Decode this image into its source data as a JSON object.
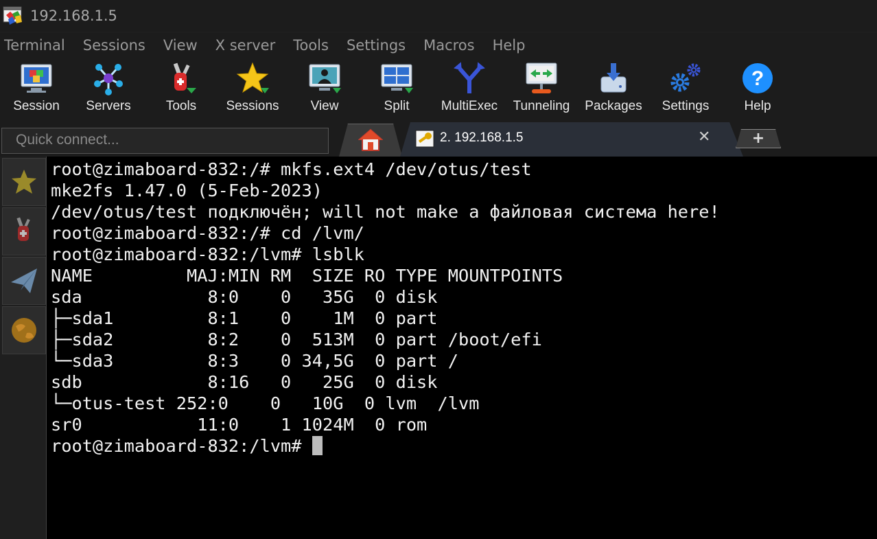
{
  "window": {
    "title": "192.168.1.5"
  },
  "menu": [
    "Terminal",
    "Sessions",
    "View",
    "X server",
    "Tools",
    "Settings",
    "Macros",
    "Help"
  ],
  "toolbar": [
    {
      "label": "Session",
      "icon": "session-icon"
    },
    {
      "label": "Servers",
      "icon": "servers-icon"
    },
    {
      "label": "Tools",
      "icon": "tools-icon"
    },
    {
      "label": "Sessions",
      "icon": "star-icon"
    },
    {
      "label": "View",
      "icon": "view-icon"
    },
    {
      "label": "Split",
      "icon": "split-icon"
    },
    {
      "label": "MultiExec",
      "icon": "multiexec-icon"
    },
    {
      "label": "Tunneling",
      "icon": "tunneling-icon"
    },
    {
      "label": "Packages",
      "icon": "packages-icon"
    },
    {
      "label": "Settings",
      "icon": "gears-icon"
    },
    {
      "label": "Help",
      "icon": "help-icon"
    }
  ],
  "tabs": {
    "quick_connect_placeholder": "Quick connect...",
    "active_tab_label": "2. 192.168.1.5",
    "close_symbol": "✕",
    "new_tab_symbol": "+"
  },
  "sidebar": [
    "star-icon",
    "tools-icon",
    "send-icon",
    "globe-icon"
  ],
  "terminal": {
    "lines": [
      "root@zimaboard-832:/# mkfs.ext4 /dev/otus/test",
      "mke2fs 1.47.0 (5-Feb-2023)",
      "/dev/otus/test подключён; will not make a файловая система here!",
      "root@zimaboard-832:/# cd /lvm/",
      "root@zimaboard-832:/lvm# lsblk",
      "NAME         MAJ:MIN RM  SIZE RO TYPE MOUNTPOINTS",
      "sda            8:0    0   35G  0 disk",
      "├─sda1         8:1    0    1M  0 part",
      "├─sda2         8:2    0  513M  0 part /boot/efi",
      "└─sda3         8:3    0 34,5G  0 part /",
      "sdb            8:16   0   25G  0 disk",
      "└─otus-test 252:0    0   10G  0 lvm  /lvm",
      "sr0           11:0    1 1024M  0 rom",
      "root@zimaboard-832:/lvm#"
    ]
  },
  "colors": {
    "accent_blue": "#1e90ff",
    "background": "#1c1c1c",
    "terminal_bg": "#000000"
  }
}
